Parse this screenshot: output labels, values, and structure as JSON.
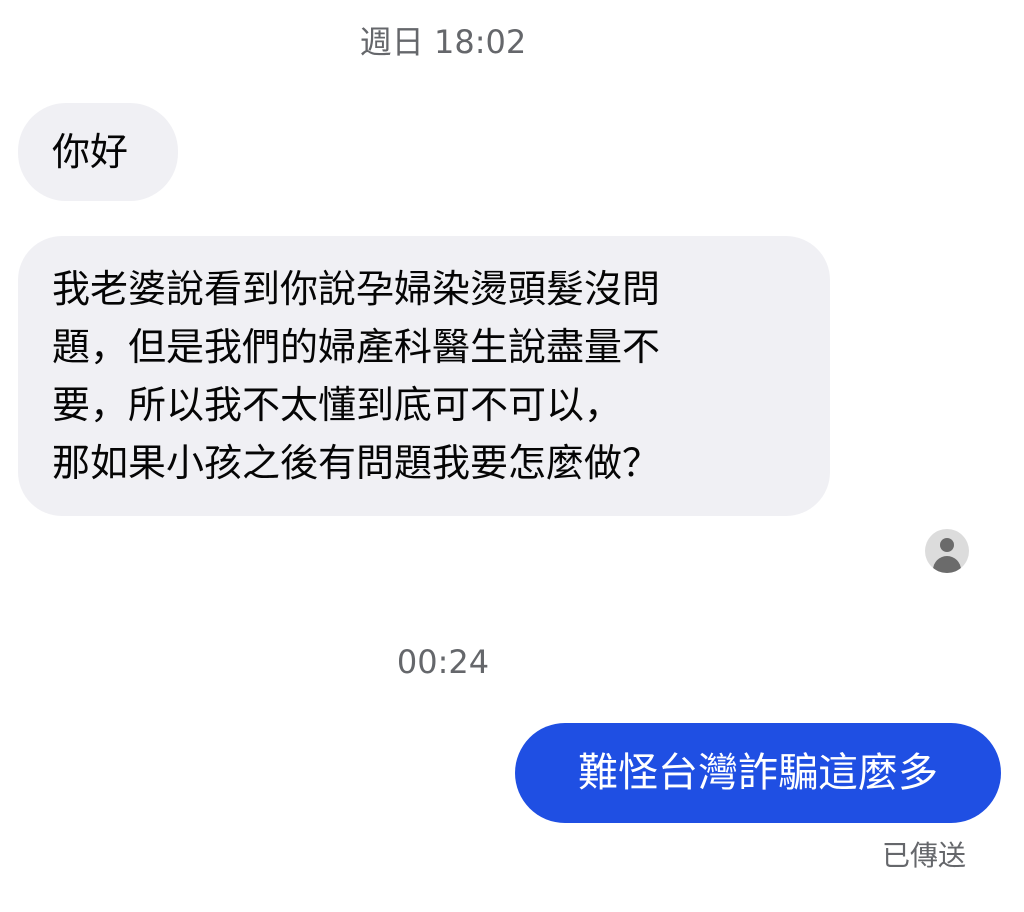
{
  "thread": {
    "timestamp_1": "週日 18:02",
    "timestamp_2": "00:24"
  },
  "messages": [
    {
      "direction": "incoming",
      "lines": [
        "你好"
      ]
    },
    {
      "direction": "incoming",
      "lines": [
        "我老婆說看到你說孕婦染燙頭髮沒問",
        "題，但是我們的婦產科醫生說盡量不",
        "要，所以我不太懂到底可不可以，",
        "那如果小孩之後有問題我要怎麼做？"
      ]
    },
    {
      "direction": "outgoing",
      "lines": [
        "難怪台灣詐騙這麼多"
      ],
      "status": "已傳送"
    }
  ],
  "avatar": {
    "icon": "user-placeholder-icon"
  },
  "colors": {
    "incoming_bubble": "#f0f0f4",
    "outgoing_bubble": "#1f4fe3",
    "meta_text": "#65676b"
  }
}
